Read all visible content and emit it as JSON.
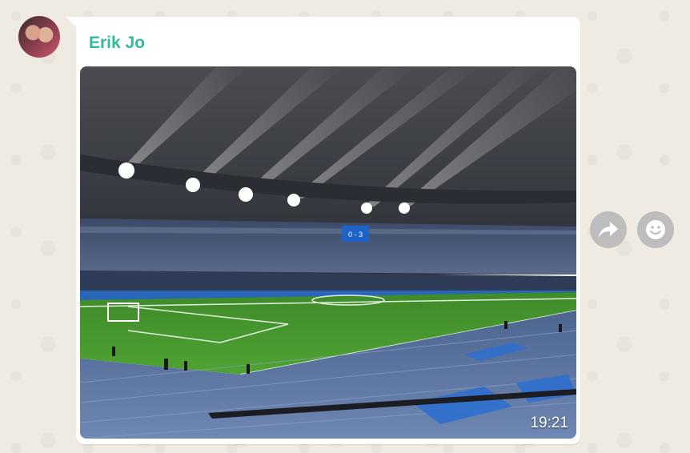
{
  "message": {
    "sender_name": "Erik Jo",
    "sender_color": "#35b99a",
    "time": "19:21",
    "media_type": "photo"
  },
  "photo_scene": {
    "scoreboard_text": "0 - 3"
  },
  "actions": {
    "forward_icon": "forward-icon",
    "react_icon": "emoji-smile-icon"
  },
  "colors": {
    "background": "#efeae2",
    "bubble": "#ffffff",
    "action_button": "#bdbdbd"
  }
}
